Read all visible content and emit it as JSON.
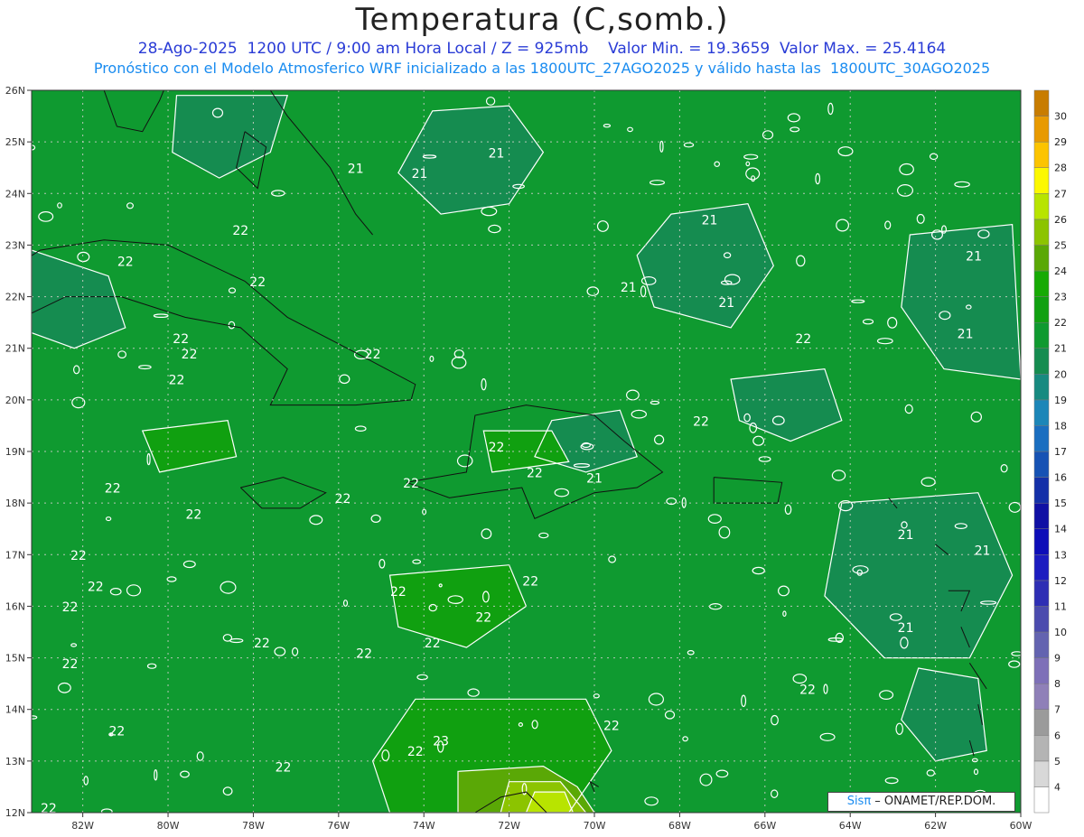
{
  "title": "Temperatura (C,somb.)",
  "subtitle_line1": "28-Ago-2025  1200 UTC / 9:00 am Hora Local / Z = 925mb    Valor Min. = 19.3659  Valor Max. = 25.4164",
  "subtitle_line2": "Pronóstico con el Modelo Atmosferico WRF inicializado a las 1800UTC_27AGO2025 y válido hasta las  1800UTC_30AGO2025",
  "credit_brand": "Sisπ",
  "credit_text": " – ONAMET/REP.DOM.",
  "map": {
    "lon_range": [
      -83.2,
      -60
    ],
    "lat_range": [
      12,
      26
    ],
    "lon_ticks": [
      "82W",
      "80W",
      "78W",
      "76W",
      "74W",
      "72W",
      "70W",
      "68W",
      "66W",
      "64W",
      "62W",
      "60W"
    ],
    "lat_ticks": [
      "12N",
      "13N",
      "14N",
      "15N",
      "16N",
      "17N",
      "18N",
      "19N",
      "20N",
      "21N",
      "22N",
      "23N",
      "24N",
      "25N",
      "26N"
    ],
    "grid": true,
    "contour_labels": [
      {
        "text": "21",
        "lon": -72.3,
        "lat": 24.7
      },
      {
        "text": "21",
        "lon": -75.6,
        "lat": 24.4
      },
      {
        "text": "21",
        "lon": -74.1,
        "lat": 24.3
      },
      {
        "text": "21",
        "lon": -67.3,
        "lat": 23.4
      },
      {
        "text": "21",
        "lon": -61.1,
        "lat": 22.7
      },
      {
        "text": "21",
        "lon": -69.2,
        "lat": 22.1
      },
      {
        "text": "21",
        "lon": -66.9,
        "lat": 21.8
      },
      {
        "text": "21",
        "lon": -61.3,
        "lat": 21.2
      },
      {
        "text": "22",
        "lon": -78.3,
        "lat": 23.2
      },
      {
        "text": "22",
        "lon": -81.0,
        "lat": 22.6
      },
      {
        "text": "22",
        "lon": -77.9,
        "lat": 22.2
      },
      {
        "text": "22",
        "lon": -79.7,
        "lat": 21.1
      },
      {
        "text": "22",
        "lon": -79.5,
        "lat": 20.8
      },
      {
        "text": "22",
        "lon": -79.8,
        "lat": 20.3
      },
      {
        "text": "22",
        "lon": -75.2,
        "lat": 20.8
      },
      {
        "text": "22",
        "lon": -65.1,
        "lat": 21.1
      },
      {
        "text": "22",
        "lon": -67.5,
        "lat": 19.5
      },
      {
        "text": "22",
        "lon": -72.3,
        "lat": 19.0
      },
      {
        "text": "22",
        "lon": -74.3,
        "lat": 18.3
      },
      {
        "text": "22",
        "lon": -71.4,
        "lat": 18.5
      },
      {
        "text": "21",
        "lon": -70.0,
        "lat": 18.4
      },
      {
        "text": "22",
        "lon": -75.9,
        "lat": 18.0
      },
      {
        "text": "22",
        "lon": -81.3,
        "lat": 18.2
      },
      {
        "text": "22",
        "lon": -79.4,
        "lat": 17.7
      },
      {
        "text": "22",
        "lon": -82.1,
        "lat": 16.9
      },
      {
        "text": "22",
        "lon": -81.7,
        "lat": 16.3
      },
      {
        "text": "22",
        "lon": -82.3,
        "lat": 15.9
      },
      {
        "text": "22",
        "lon": -71.5,
        "lat": 16.4
      },
      {
        "text": "22",
        "lon": -74.6,
        "lat": 16.2
      },
      {
        "text": "22",
        "lon": -72.6,
        "lat": 15.7
      },
      {
        "text": "22",
        "lon": -77.8,
        "lat": 15.2
      },
      {
        "text": "22",
        "lon": -75.4,
        "lat": 15.0
      },
      {
        "text": "22",
        "lon": -73.8,
        "lat": 15.2
      },
      {
        "text": "22",
        "lon": -82.3,
        "lat": 14.8
      },
      {
        "text": "22",
        "lon": -65.0,
        "lat": 14.3
      },
      {
        "text": "22",
        "lon": -69.6,
        "lat": 13.6
      },
      {
        "text": "22",
        "lon": -81.2,
        "lat": 13.5
      },
      {
        "text": "22",
        "lon": -74.2,
        "lat": 13.1
      },
      {
        "text": "23",
        "lon": -73.6,
        "lat": 13.3
      },
      {
        "text": "22",
        "lon": -77.3,
        "lat": 12.8
      },
      {
        "text": "22",
        "lon": -82.8,
        "lat": 12.0
      },
      {
        "text": "21",
        "lon": -62.7,
        "lat": 17.3
      },
      {
        "text": "21",
        "lon": -60.9,
        "lat": 17.0
      },
      {
        "text": "21",
        "lon": -62.7,
        "lat": 15.5
      }
    ]
  },
  "colorbar": {
    "levels": [
      4,
      5,
      6,
      7,
      8,
      9,
      10,
      11,
      12,
      13,
      14,
      15,
      16,
      17,
      18,
      19,
      20,
      21,
      22,
      23,
      24,
      25,
      26,
      27,
      28,
      29,
      30
    ],
    "colors": [
      "#ffffff",
      "#d8d8d8",
      "#b4b4b4",
      "#9b9b9b",
      "#8f80b8",
      "#7e70b8",
      "#6363b0",
      "#4b4bae",
      "#2e2eb4",
      "#1c1cc0",
      "#0d0db8",
      "#1010a4",
      "#1430a8",
      "#1652b4",
      "#1a6ec0",
      "#1c86b8",
      "#178a80",
      "#158c50",
      "#0f9a30",
      "#10a010",
      "#16aa04",
      "#5aa806",
      "#8cc400",
      "#b8e400",
      "#fcf800",
      "#fcc400",
      "#e89a00",
      "#c87c00"
    ]
  },
  "legend_colors": {
    "shade_21": "#158c50",
    "shade_22": "#0f9a30",
    "shade_23": "#10a010",
    "shade_24": "#5aa806",
    "shade_25": "#8cc400",
    "shade_26": "#b8e400"
  }
}
